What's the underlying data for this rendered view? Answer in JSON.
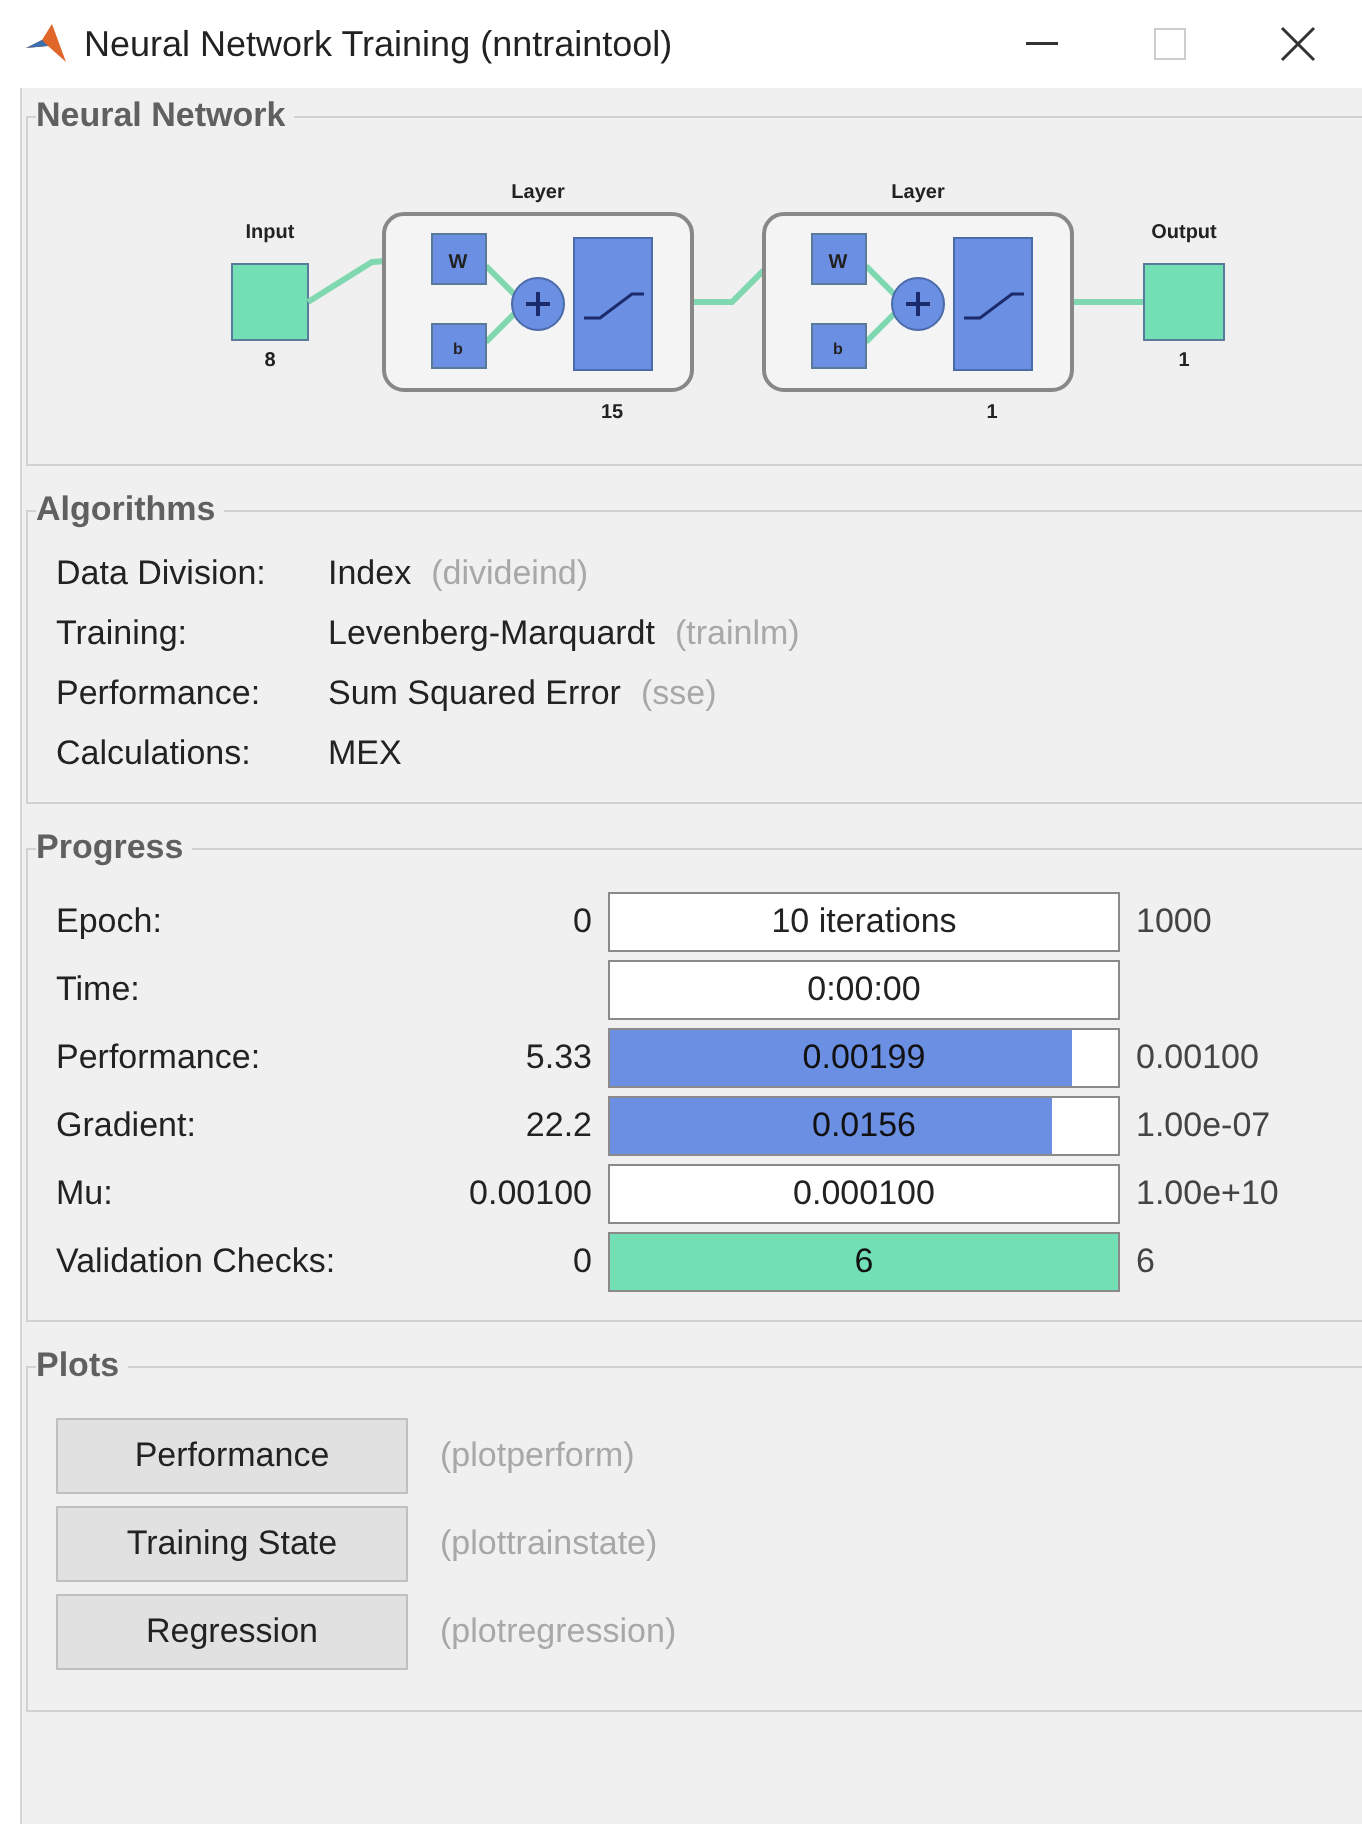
{
  "window": {
    "title": "Neural Network Training (nntraintool)"
  },
  "neural_network": {
    "title": "Neural Network",
    "input": {
      "label": "Input",
      "size": "8"
    },
    "layers": [
      {
        "label": "Layer",
        "weight": "W",
        "bias": "b",
        "size": "15"
      },
      {
        "label": "Layer",
        "weight": "W",
        "bias": "b",
        "size": "1"
      }
    ],
    "output": {
      "label": "Output",
      "size": "1"
    }
  },
  "algorithms": {
    "title": "Algorithms",
    "rows": [
      {
        "label": "Data Division:",
        "value": "Index",
        "function": "(divideind)"
      },
      {
        "label": "Training:",
        "value": "Levenberg-Marquardt",
        "function": "(trainlm)"
      },
      {
        "label": "Performance:",
        "value": "Sum Squared Error",
        "function": "(sse)"
      },
      {
        "label": "Calculations:",
        "value": "MEX"
      }
    ]
  },
  "progress": {
    "title": "Progress",
    "rows": [
      {
        "kind": "readout",
        "label": "Epoch:",
        "min": "0",
        "value": "10 iterations",
        "max": "1000"
      },
      {
        "kind": "readout",
        "label": "Time:",
        "value": "0:00:00"
      },
      {
        "kind": "meter",
        "label": "Performance:",
        "min": "5.33",
        "value": "0.00199",
        "level": 0.91,
        "color": "#6b8fe3",
        "max": "0.00100"
      },
      {
        "kind": "meter",
        "label": "Gradient:",
        "min": "22.2",
        "value": "0.0156",
        "level": 0.87,
        "color": "#6b8fe3",
        "max": "1.00e-07"
      },
      {
        "kind": "readout",
        "label": "Mu:",
        "min": "0.00100",
        "value": "0.000100",
        "max": "1.00e+10"
      },
      {
        "kind": "meter",
        "label": "Validation Checks:",
        "min": "0",
        "value": "6",
        "level": 1,
        "color": "#72e0b4",
        "max": "6"
      }
    ]
  },
  "plots": {
    "title": "Plots",
    "buttons": [
      {
        "label": "Performance",
        "function": "(plotperform)"
      },
      {
        "label": "Training State",
        "function": "(plottrainstate)"
      },
      {
        "label": "Regression",
        "function": "(plotregression)"
      }
    ]
  }
}
